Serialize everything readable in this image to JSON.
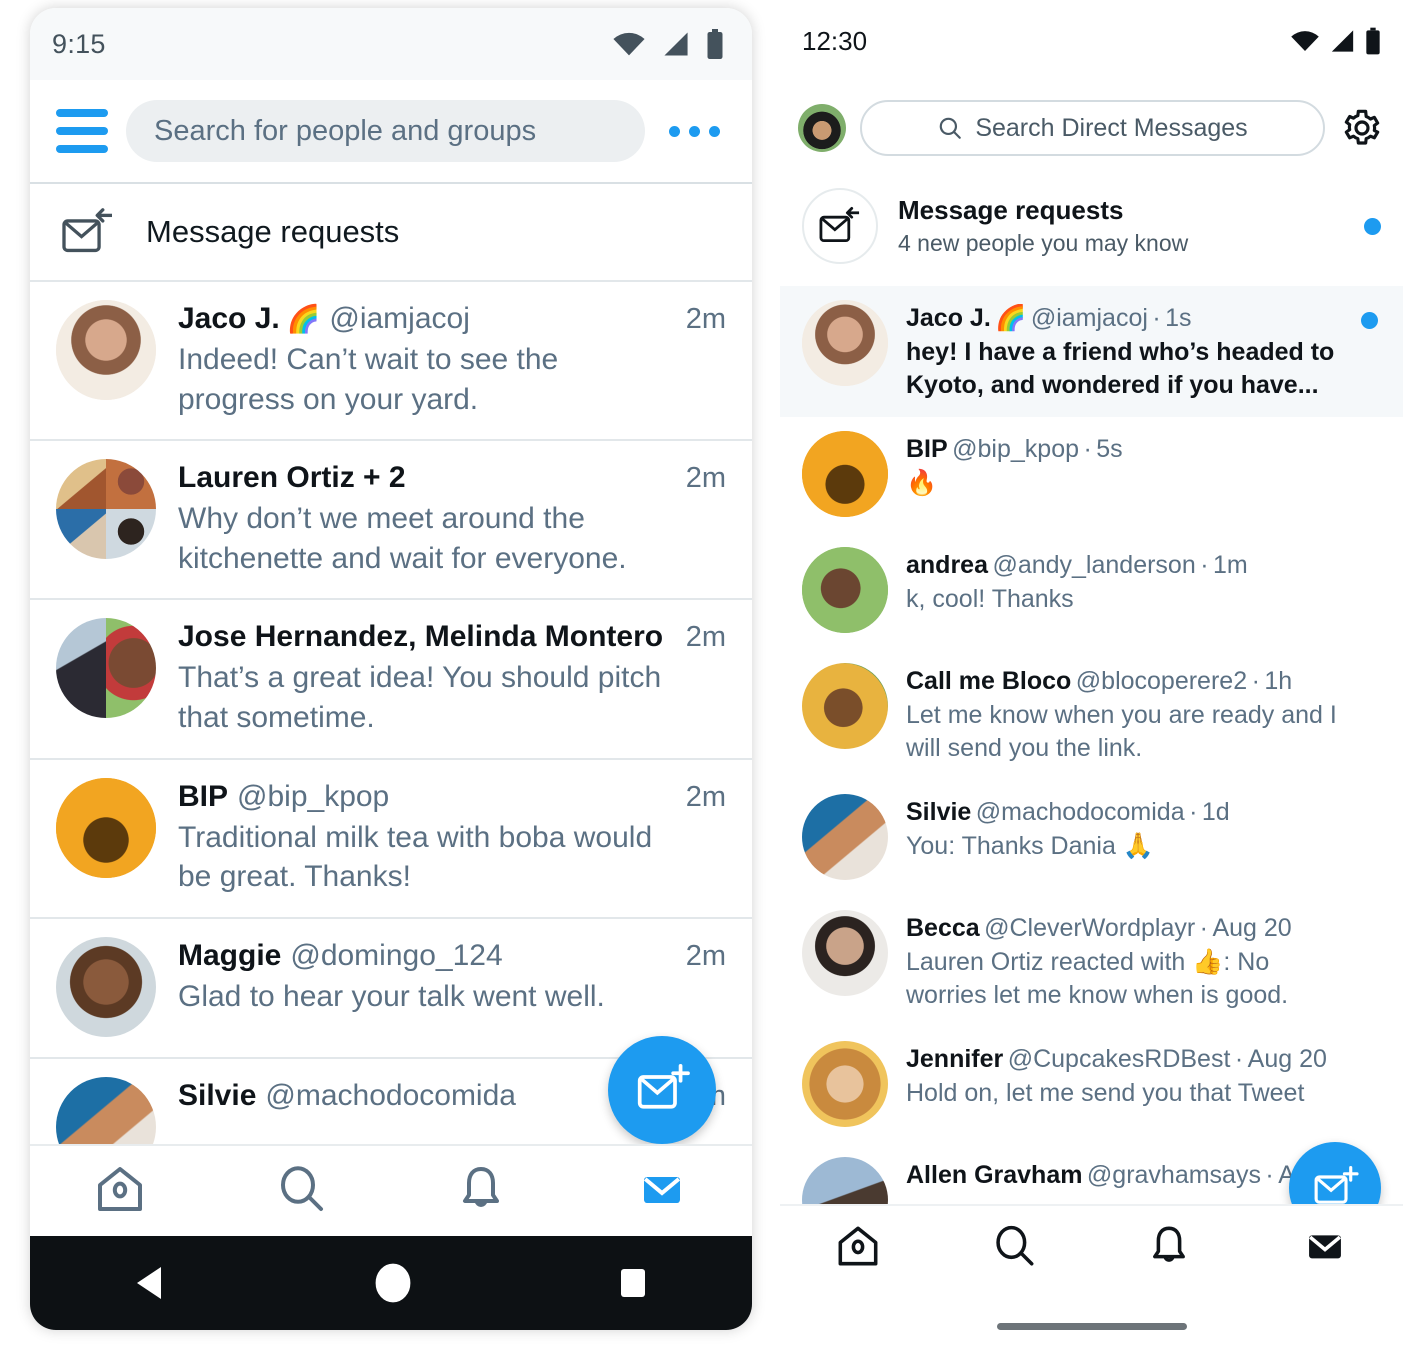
{
  "left": {
    "status": {
      "time": "9:15",
      "icons": [
        "wifi-icon",
        "signal-icon",
        "battery-icon"
      ]
    },
    "appbar": {
      "menu_icon": "hamburger-menu-icon",
      "search_placeholder": "Search for people and groups",
      "overflow_icon": "more-options-icon"
    },
    "message_requests": {
      "label": "Message requests",
      "icon": "message-request-icon"
    },
    "conversations": [
      {
        "name": "Jaco J.",
        "emoji": "🌈",
        "handle": "@iamjacoj",
        "time": "2m",
        "preview": "Indeed! Can’t wait to see the progress on your yard.",
        "avatar": "jaco"
      },
      {
        "name": "Lauren Ortiz + 2",
        "emoji": "",
        "handle": "",
        "time": "2m",
        "preview": "Why don’t we meet around the kitchenette and wait for everyone.",
        "avatar": "group-quad"
      },
      {
        "name": "Jose Hernandez, Melinda Montero",
        "emoji": "",
        "handle": "",
        "time": "2m",
        "preview": "That’s a great idea! You should pitch that sometime.",
        "avatar": "group-duo"
      },
      {
        "name": "BIP",
        "emoji": "",
        "handle": "@bip_kpop",
        "time": "2m",
        "preview": "Traditional milk tea with boba would be great. Thanks!",
        "avatar": "bip"
      },
      {
        "name": "Maggie",
        "emoji": "",
        "handle": "@domingo_124",
        "time": "2m",
        "preview": "Glad to hear your talk went well.",
        "avatar": "maggie"
      },
      {
        "name": "Silvie",
        "emoji": "",
        "handle": "@machodocomida",
        "time": "2m",
        "preview": "",
        "avatar": "silvie"
      }
    ],
    "fab": {
      "icon": "new-message-icon",
      "color": "#1d9bf0"
    },
    "tabs": [
      {
        "icon": "home-icon",
        "active": false
      },
      {
        "icon": "search-icon",
        "active": false
      },
      {
        "icon": "notifications-bell-icon",
        "active": false
      },
      {
        "icon": "messages-envelope-icon",
        "active": true
      }
    ],
    "system_nav": [
      "back-triangle-icon",
      "home-circle-icon",
      "recents-square-icon"
    ]
  },
  "right": {
    "status": {
      "time": "12:30",
      "icons": [
        "wifi-icon",
        "signal-icon",
        "battery-icon"
      ]
    },
    "appbar": {
      "avatar": "me",
      "search_placeholder": "Search Direct Messages",
      "search_icon": "search-icon",
      "settings_icon": "gear-icon"
    },
    "message_requests": {
      "title": "Message requests",
      "subtitle": "4 new people you may know",
      "icon": "message-request-icon",
      "unread": true
    },
    "conversations": [
      {
        "name": "Jaco J.",
        "emoji": "🌈",
        "handle": "@iamjacoj",
        "sep": "·",
        "time": "1s",
        "preview": "hey! I have a friend who’s headed to Kyoto, and wondered if you have...",
        "unread": true,
        "highlighted": true,
        "avatar": "jaco"
      },
      {
        "name": "BIP",
        "emoji": "",
        "handle": "@bip_kpop",
        "sep": "·",
        "time": "5s",
        "preview": "🔥",
        "unread": false,
        "highlighted": false,
        "avatar": "bip"
      },
      {
        "name": "andrea",
        "emoji": "",
        "handle": "@andy_landerson",
        "sep": "·",
        "time": "1m",
        "preview": "k, cool! Thanks",
        "unread": false,
        "highlighted": false,
        "avatar": "andrea"
      },
      {
        "name": "Call me Bloco",
        "emoji": "",
        "handle": "@blocoperere2",
        "sep": "·",
        "time": "1h",
        "preview": "Let me know when you are ready and I will send you the link.",
        "unread": false,
        "highlighted": false,
        "avatar": "bloco"
      },
      {
        "name": "Silvie",
        "emoji": "",
        "handle": "@machodocomida",
        "sep": "·",
        "time": "1d",
        "preview": "You: Thanks Dania 🙏",
        "unread": false,
        "highlighted": false,
        "avatar": "silvie"
      },
      {
        "name": "Becca",
        "emoji": "",
        "handle": "@CleverWordplayr",
        "sep": "·",
        "time": "Aug 20",
        "preview": "Lauren Ortiz reacted with 👍: No worries let me know when is good.",
        "unread": false,
        "highlighted": false,
        "avatar": "becca"
      },
      {
        "name": "Jennifer",
        "emoji": "",
        "handle": "@CupcakesRDBest",
        "sep": "·",
        "time": "Aug 20",
        "preview": "Hold on, let me send you that Tweet",
        "unread": false,
        "highlighted": false,
        "avatar": "jennifer"
      },
      {
        "name": "Allen Gravham",
        "emoji": "",
        "handle": "@gravhamsays",
        "sep": "·",
        "time": "Aug 20",
        "preview": "",
        "unread": false,
        "highlighted": false,
        "avatar": "allen"
      }
    ],
    "fab": {
      "icon": "new-message-icon",
      "color": "#1d9bf0"
    },
    "tabs": [
      {
        "icon": "home-icon",
        "active": false
      },
      {
        "icon": "search-icon",
        "active": false
      },
      {
        "icon": "notifications-bell-icon",
        "active": false
      },
      {
        "icon": "messages-envelope-icon",
        "active": true
      }
    ],
    "home_indicator": "home-indicator-bar"
  },
  "colors": {
    "accent": "#1d9bf0",
    "text": "#0f1419",
    "muted": "#5b7083",
    "highlight": "#f5f8fa"
  }
}
